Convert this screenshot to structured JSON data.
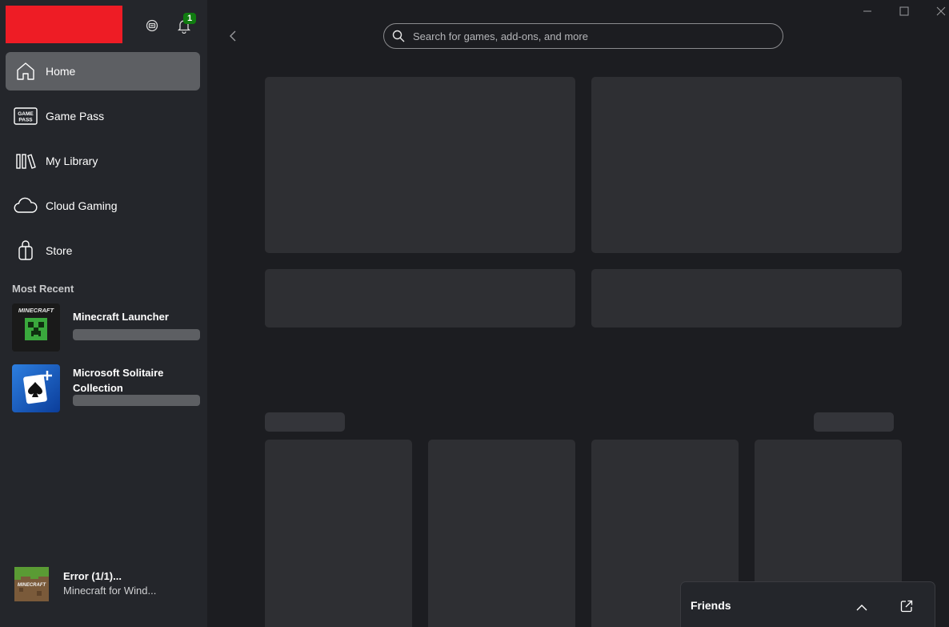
{
  "notifications": {
    "count": "1"
  },
  "nav": {
    "items": [
      {
        "label": "Home",
        "icon": "home-icon"
      },
      {
        "label": "Game Pass",
        "icon": "game-pass-icon"
      },
      {
        "label": "My Library",
        "icon": "library-icon"
      },
      {
        "label": "Cloud Gaming",
        "icon": "cloud-icon"
      },
      {
        "label": "Store",
        "icon": "store-bag-icon"
      }
    ]
  },
  "recent": {
    "heading": "Most Recent",
    "items": [
      {
        "title": "Minecraft Launcher",
        "thumb_text": "MINECRAFT"
      },
      {
        "title": "Microsoft Solitaire Collection"
      }
    ]
  },
  "status": {
    "title": "Error (1/1)...",
    "subtitle": "Minecraft for Wind...",
    "thumb_text": "MINECRAFT"
  },
  "search": {
    "placeholder": "Search for games, add-ons, and more"
  },
  "friends": {
    "label": "Friends"
  },
  "colors": {
    "brand_red": "#ee1c25",
    "badge_green": "#107c10",
    "sidebar_bg": "#24262b",
    "main_bg": "#1c1d21",
    "placeholder": "#2e2f33",
    "active_item": "#5d5f63"
  }
}
